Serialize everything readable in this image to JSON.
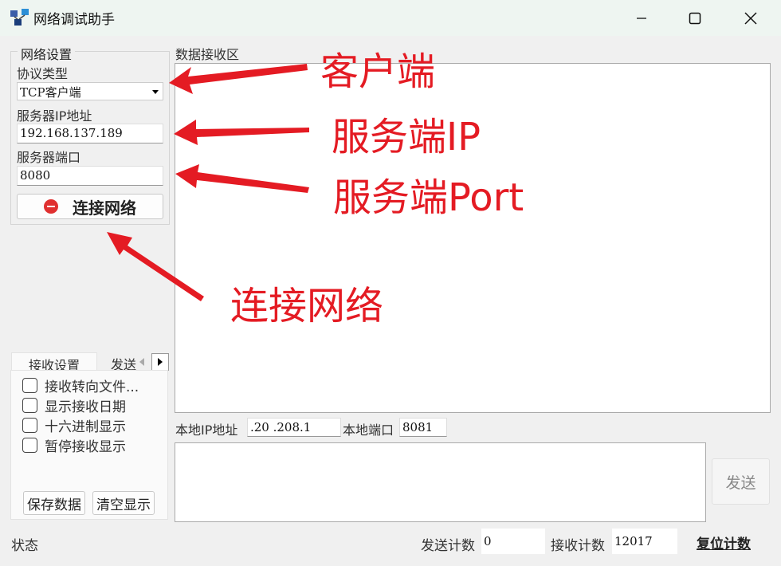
{
  "window": {
    "title": "网络调试助手"
  },
  "network_settings": {
    "group_title": "网络设置",
    "protocol_label": "协议类型",
    "protocol_value": "TCP客户端",
    "server_ip_label": "服务器IP地址",
    "server_ip_value": "192.168.137.189",
    "server_port_label": "服务器端口",
    "server_port_value": "8080",
    "connect_button_label": "连接网络"
  },
  "receive_area": {
    "label": "数据接收区"
  },
  "tabs": {
    "receive_settings": "接收设置",
    "send_settings_partial": "发送"
  },
  "receive_options": [
    {
      "label": "接收转向文件...",
      "checked": false
    },
    {
      "label": "显示接收日期",
      "checked": false
    },
    {
      "label": "十六进制显示",
      "checked": false
    },
    {
      "label": "暂停接收显示",
      "checked": false
    }
  ],
  "receive_buttons": {
    "save": "保存数据",
    "clear": "清空显示"
  },
  "local": {
    "ip_label": "本地IP地址",
    "ip_value": ".20 .208.1",
    "port_label": "本地端口",
    "port_value": "8081"
  },
  "send": {
    "button_label": "发送"
  },
  "status_bar": {
    "status_label": "状态",
    "send_count_label": "发送计数",
    "send_count_value": "0",
    "recv_count_label": "接收计数",
    "recv_count_value": "12017",
    "reset_label": "复位计数"
  },
  "annotations": {
    "client": "客户端",
    "server_ip": "服务端IP",
    "server_port": "服务端Port",
    "connect": "连接网络"
  },
  "colors": {
    "annotation": "#e41b23",
    "titlebar": "#eef5f1"
  }
}
